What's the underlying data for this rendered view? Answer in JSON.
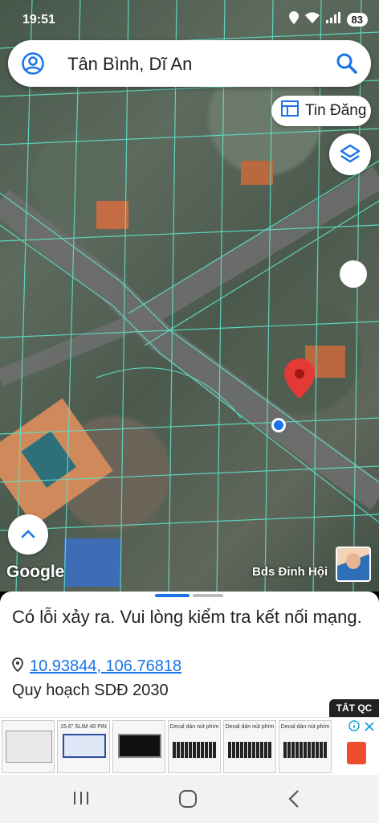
{
  "status": {
    "time": "19:51",
    "battery": "83"
  },
  "search": {
    "query": "Tân Bình, Dĩ An"
  },
  "map": {
    "post_button_label": "Tin Đăng",
    "watermark": "Google",
    "poster_name": "Bds Đinh Hội"
  },
  "sheet": {
    "error_message": "Có lỗi xảy ra. Vui lòng kiểm tra kết nối mạng.",
    "coordinates": "10.93844, 106.76818",
    "plan_label": "Quy hoạch SDĐ 2030"
  },
  "ad": {
    "close_label": "TẮT QC",
    "items": [
      {
        "caption": ""
      },
      {
        "caption": "15.6\" SLIM 40 PIN"
      },
      {
        "caption": ""
      },
      {
        "caption": "Decal dán nút phím"
      },
      {
        "caption": "Decal dán nút phím"
      },
      {
        "caption": "Decal dán nút phím"
      }
    ]
  },
  "colors": {
    "accent": "#1a73e8",
    "pin": "#e53935",
    "parcel_lines": "#5fe0c8"
  }
}
